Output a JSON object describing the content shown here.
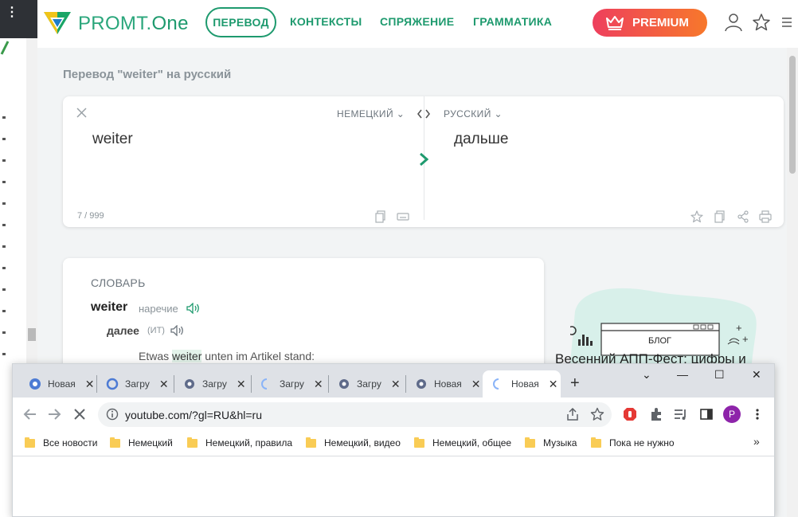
{
  "left_window": {
    "menu_glyph": "⋮"
  },
  "header": {
    "logo_text": "PROMT.",
    "logo_text_accent": "One",
    "nav": [
      "ПЕРЕВОД",
      "КОНТЕКСТЫ",
      "СПРЯЖЕНИЕ",
      "ГРАММАТИКА"
    ],
    "premium_label": "PREMIUM",
    "icons": [
      "user-icon",
      "star-icon",
      "menu-icon"
    ]
  },
  "page_heading": "Перевод \"weiter\" на русский",
  "translator": {
    "source_lang": "НЕМЕЦКИЙ",
    "target_lang": "РУССКИЙ",
    "source_text": "weiter",
    "target_text": "дальше",
    "char_count": "7 / 999"
  },
  "dictionary": {
    "title": "СЛОВАРЬ",
    "word": "weiter",
    "part_of_speech": "наречие",
    "sense": "далее",
    "sense_tag": "(ИТ)",
    "example_before": "Etwas ",
    "example_highlight": "weiter",
    "example_after": " unten im Artikel stand:"
  },
  "blog": {
    "badge": "БЛОГ",
    "title": "Весенний АПП-Фест: цифры и"
  },
  "browser": {
    "tabs": [
      {
        "label": "Новая",
        "icon": "chrome-icon"
      },
      {
        "label": "Загру",
        "icon": "chrome-icon"
      },
      {
        "label": "Загру",
        "icon": "chrome-icon"
      },
      {
        "label": "Загру",
        "icon": "loading-icon"
      },
      {
        "label": "Загру",
        "icon": "chrome-icon"
      },
      {
        "label": "Новая",
        "icon": "chrome-icon"
      },
      {
        "label": "Новая",
        "icon": "loading-icon",
        "active": true
      }
    ],
    "new_tab": "+",
    "window_controls": [
      "⌄",
      "—",
      "☐",
      "✕"
    ],
    "url": "youtube.com/?gl=RU&hl=ru",
    "profile_initial": "P",
    "bookmarks": [
      "Все новости",
      "Немецкий",
      "Немецкий, правила",
      "Немецкий, видео",
      "Немецкий, общее",
      "Музыка",
      "Пока не нужно"
    ],
    "bookmarks_more": "»"
  },
  "colors": {
    "brand_green": "#1e9a6e",
    "premium_start": "#ee3f5d",
    "premium_end": "#f7782b",
    "page_bg": "#f2f4f5",
    "profile_purple": "#8e24aa"
  }
}
